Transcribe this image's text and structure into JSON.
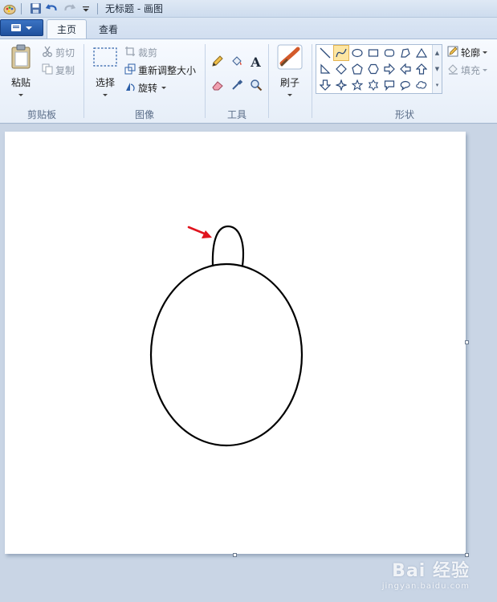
{
  "window": {
    "title": "无标题 - 画图"
  },
  "tabs": {
    "home": "主页",
    "view": "查看"
  },
  "clipboard": {
    "paste": "粘贴",
    "cut": "剪切",
    "copy": "复制",
    "group_label": "剪贴板"
  },
  "image": {
    "select": "选择",
    "crop": "裁剪",
    "resize": "重新调整大小",
    "rotate": "旋转",
    "group_label": "图像"
  },
  "tools": {
    "group_label": "工具",
    "text_glyph": "A"
  },
  "brushes": {
    "label": "刷子"
  },
  "shapes": {
    "outline": "轮廓",
    "fill": "填充",
    "group_label": "形状"
  },
  "watermark": {
    "main": "Bai  经验",
    "sub": "jingyan.baidu.com"
  },
  "colors": {
    "accent": "#1f4f9c",
    "arrow": "#e0141e",
    "selected_shape": "#fde6a2"
  }
}
